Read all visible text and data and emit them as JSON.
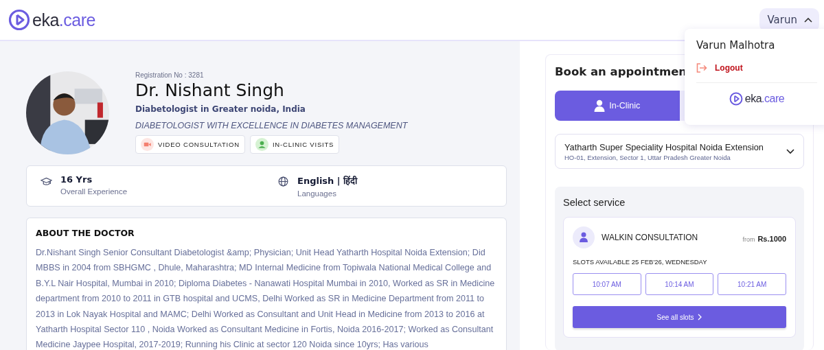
{
  "header": {
    "logo": {
      "name": "eka",
      "suffix": ".care"
    },
    "user_button": {
      "label": "Varun",
      "expanded": true
    }
  },
  "user_menu": {
    "full_name": "Varun Malhotra",
    "logout": "Logout",
    "logo": {
      "name": "eka",
      "suffix": ".care"
    }
  },
  "doctor": {
    "registration": "Registration No : 3281",
    "name": "Dr. Nishant Singh",
    "specialty": "Diabetologist in Greater noida, India",
    "tagline": "DIABETOLOGIST WITH EXCELLENCE IN DIABETES MANAGEMENT",
    "badges": [
      {
        "kind": "video",
        "label": "VIDEO CONSULTATION"
      },
      {
        "kind": "clinic",
        "label": "IN-CLINIC VISITS"
      }
    ]
  },
  "stats": [
    {
      "kind": "experience",
      "value": "16 Yrs",
      "label": "Overall Experience"
    },
    {
      "kind": "languages",
      "value": "English | हिंदी",
      "label": "Languages"
    }
  ],
  "about": {
    "title": "ABOUT THE DOCTOR",
    "text": "Dr.Nishant Singh Senior Consultant Diabetologist &amp; Physician; Unit Head Yatharth Hospital Noida Extension; Did MBBS in 2004 from SBHGMC , Dhule, Maharashtra; MD Internal Medicine from Topiwala National Medical College and B.Y.L Nair Hospital, Mumbai in 2010; Diploma Diabetes - Nanawati Hospital Mumbai in 2010, Worked as SR in Medicine department from 2010 to 2011 in GTB hospital and UCMS, Delhi Worked as SR in Medicine Department from 2011 to 2013 in Lok Nayak Hospital and MAMC; Delhi Worked as Consultant and Unit Head in Medicine from 2013 to 2016 at Yatharth Hospital Sector 110 , Noida Worked as Consultant Medicine in Fortis, Noida 2016-2017; Worked as Consultant Medicine Jaypee Hospital, 2017-2019; Running his Clinic at sector 120 Noida since 10yrs; Has various"
  },
  "booking": {
    "title": "Book an appointmen",
    "tabs": [
      {
        "label": "In-Clinic",
        "selected": true
      },
      {
        "selected": false
      }
    ],
    "clinic": {
      "name": "Yatharth Super Speciality Hospital Noida Extension",
      "address": "HO-01, Extension, Sector 1, Uttar Pradesh Greater Noida"
    },
    "service_title": "Select service",
    "service": {
      "name": "WALKIN CONSULTATION",
      "price_prefix": "from",
      "price": "Rs.1000",
      "slots_label": "SLOTS AVAILABLE 25 FEB'26, WEDNESDAY",
      "slots": [
        "10:07 AM",
        "10:14 AM",
        "10:21 AM"
      ],
      "see_all": "See all slots"
    }
  }
}
